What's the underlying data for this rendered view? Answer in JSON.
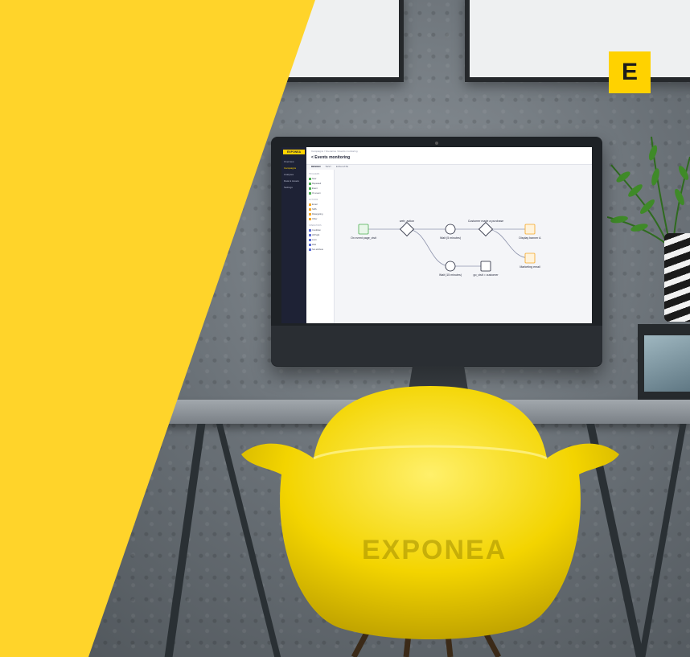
{
  "brand": {
    "logo_letter": "E",
    "chair_logo": "EXPONEA",
    "accent": "#ffd200",
    "dark": "#1e2235"
  },
  "screen_ui": {
    "sidebar_brand": "EXPONEA",
    "sidebar_items": [
      "Overview",
      "Campaigns",
      "Analyses",
      "Data & Assets",
      "Settings"
    ],
    "active_sidebar_index": 1,
    "breadcrumb": "Campaigns / Scenarios / Events monitoring",
    "page_title": "< Events monitoring",
    "tabs": [
      "DESIGN",
      "TEST",
      "EVALUATE"
    ],
    "palette_sections": [
      {
        "heading": "TRIGGERS",
        "items": [
          "Now",
          "Repeated",
          "Event",
          "On event"
        ]
      },
      {
        "heading": "ACTIONS",
        "items": [
          "Email",
          "SMS",
          "Retargeting",
          "Other"
        ]
      },
      {
        "heading": "OPERATORS",
        "items": [
          "Condition",
          "AB Split",
          "Limit",
          "Wait",
          "Set attribute"
        ]
      }
    ],
    "flow_nodes": [
      {
        "id": "start",
        "label": "On event page_visit",
        "kind": "trigger"
      },
      {
        "id": "cond1",
        "label": "web_action",
        "kind": "condition"
      },
      {
        "id": "wait1",
        "label": "Wait (5 minutes)",
        "kind": "wait"
      },
      {
        "id": "cond2",
        "label": "Customer made a purchase",
        "kind": "condition"
      },
      {
        "id": "banner",
        "label": "Display banner A",
        "kind": "action"
      },
      {
        "id": "email",
        "label": "Marketing email",
        "kind": "action"
      },
      {
        "id": "wait2",
        "label": "Wait (15 minutes)",
        "kind": "wait"
      },
      {
        "id": "set",
        "label": "go_visit = customer",
        "kind": "set"
      }
    ]
  }
}
